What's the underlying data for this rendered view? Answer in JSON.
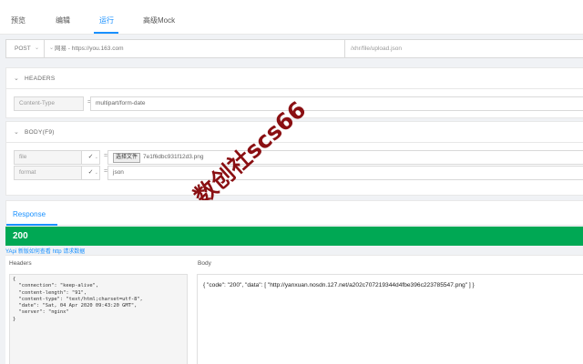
{
  "tabs": [
    {
      "label": "预览"
    },
    {
      "label": "编辑"
    },
    {
      "label": "运行"
    },
    {
      "label": "高级Mock"
    }
  ],
  "request": {
    "method": "POST",
    "host": "网易 - https://you.163.com",
    "path": "/xhr/file/upload.json"
  },
  "headers_section": {
    "title": "HEADERS",
    "rows": [
      {
        "key": "Content-Type",
        "eq": "=",
        "value": "multipart/form-date"
      }
    ]
  },
  "body_section": {
    "title": "BODY(F9)",
    "rows": [
      {
        "key": "file",
        "eq": "=",
        "file_button": "选择文件",
        "value": "7e1f6dbc931f12d3.png"
      },
      {
        "key": "format",
        "eq": "=",
        "value": "json"
      }
    ]
  },
  "watermark": "数创社scs66",
  "response": {
    "tab": "Response",
    "status": "200",
    "hint": "YApi 新版如何查看 http 请求数据",
    "headers_label": "Headers",
    "body_label": "Body",
    "headers_lines": [
      "{",
      "  \"connection\": \"keep-alive\",",
      "  \"content-length\": \"91\",",
      "  \"content-type\": \"text/html;charset=utf-8\",",
      "  \"date\": \"Sat, 04 Apr 2020 09:43:20 GMT\",",
      "  \"server\": \"nginx\"",
      "}"
    ],
    "body": "{ \"code\": \"200\", \"data\": [ \"http://yanxuan.nosdn.127.net/a202c707219344d4fbe396c223785547.png\" ] }"
  },
  "colors": {
    "accent": "#1890ff",
    "success": "#00a854",
    "watermark": "#8a0f12"
  },
  "icons": {
    "method_dropdown": "chevron-down-icon",
    "host_dropdown": "chevron-down-icon",
    "section_toggle": "chevron-down-icon",
    "checkbox": "check-icon"
  }
}
